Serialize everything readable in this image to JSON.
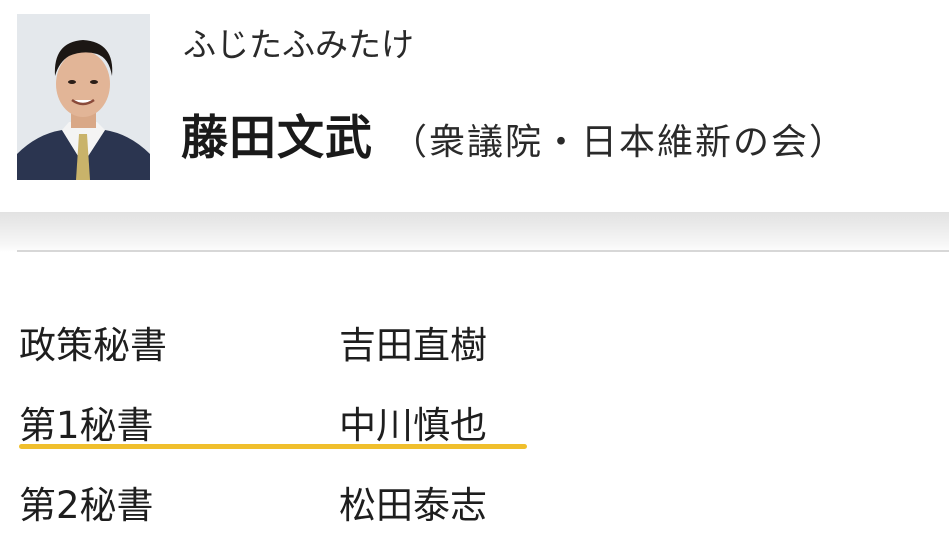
{
  "profile": {
    "kana": "ふじたふみたけ",
    "name": "藤田文武",
    "affiliation": "（衆議院・日本維新の会）",
    "photo_icon": "portrait-photo"
  },
  "staff": [
    {
      "role": "政策秘書",
      "name": "吉田直樹"
    },
    {
      "role": "第1秘書",
      "name": "中川慎也",
      "highlighted": true
    },
    {
      "role": "第2秘書",
      "name": "松田泰志"
    }
  ],
  "colors": {
    "highlight": "#f0bf2d",
    "divider": "#d7d7d7",
    "text": "#1e1e1e"
  }
}
